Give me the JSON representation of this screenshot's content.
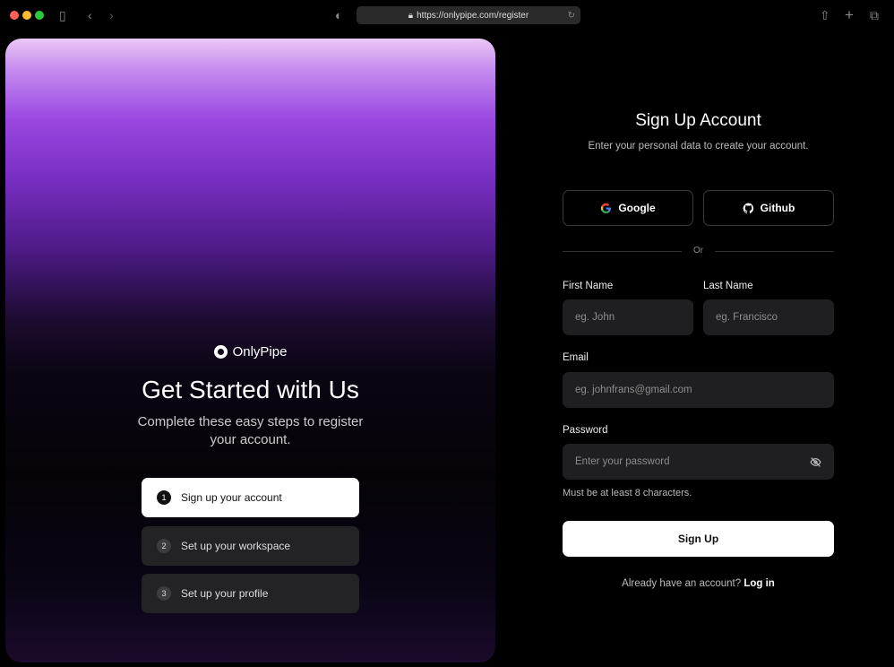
{
  "browser": {
    "url": "https://onlypipe.com/register",
    "lock_icon": "lock-icon"
  },
  "hero": {
    "brand": "OnlyPipe",
    "title": "Get Started with Us",
    "subtitle": "Complete these easy steps to register your account.",
    "steps": [
      {
        "num": "1",
        "label": "Sign up your account",
        "active": true
      },
      {
        "num": "2",
        "label": "Set up your workspace",
        "active": false
      },
      {
        "num": "3",
        "label": "Set up your profile",
        "active": false
      }
    ]
  },
  "form": {
    "title": "Sign Up Account",
    "description": "Enter your personal data to create your account.",
    "google_label": "Google",
    "github_label": "Github",
    "divider": "Or",
    "first_name_label": "First Name",
    "first_name_placeholder": "eg. John",
    "last_name_label": "Last Name",
    "last_name_placeholder": "eg. Francisco",
    "email_label": "Email",
    "email_placeholder": "eg. johnfrans@gmail.com",
    "password_label": "Password",
    "password_placeholder": "Enter your password",
    "password_hint": "Must be at least 8 characters.",
    "submit_label": "Sign Up",
    "login_prompt": "Already have an account?",
    "login_link": "Log in"
  }
}
